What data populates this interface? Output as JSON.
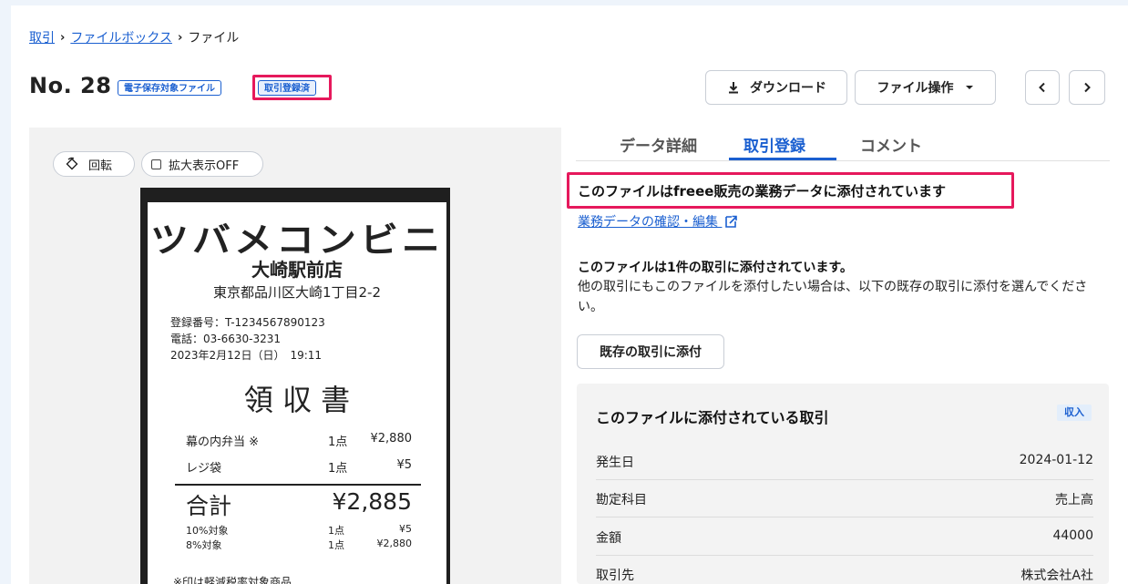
{
  "breadcrumb": {
    "item1": "取引",
    "item2": "ファイルボックス",
    "current": "ファイル",
    "separator": "›"
  },
  "header": {
    "title": "No. 28",
    "badge_storage": "電子保存対象ファイル",
    "badge_registered": "取引登録済"
  },
  "toolbar": {
    "download_label": "ダウンロード",
    "file_ops_label": "ファイル操作",
    "prev_icon": "chevron-left-icon",
    "next_icon": "chevron-right-icon"
  },
  "viewer": {
    "rotate_label": "回転",
    "zoom_label": "拡大表示OFF"
  },
  "receipt": {
    "store_name": "ツバメコンビニ",
    "branch": "大崎駅前店",
    "address": "東京都品川区大崎1丁目2-2",
    "reg_no": "登録番号：T-1234567890123",
    "phone": "電話：03-6630-3231",
    "datetime": "2023年2月12日（日）　19:11",
    "doc_title": "領 収 書",
    "items": [
      {
        "name": "幕の内弁当 ※",
        "qty": "1点",
        "price": "¥2,880"
      },
      {
        "name": "レジ袋",
        "qty": "1点",
        "price": "¥5"
      }
    ],
    "total_label": "合計",
    "total_value": "¥2,885",
    "tax_rows": [
      {
        "name": "10%対象",
        "qty": "1点",
        "price": "¥5"
      },
      {
        "name": "8%対象",
        "qty": "1点",
        "price": "¥2,880"
      }
    ],
    "footnote": "※印は軽減税率対象商品"
  },
  "tabs": [
    {
      "label": "データ詳細",
      "active": false
    },
    {
      "label": "取引登録",
      "active": true
    },
    {
      "label": "コメント",
      "active": false
    }
  ],
  "panel": {
    "notice": "このファイルはfreee販売の業務データに添付されています",
    "link": "業務データの確認・編集",
    "attached_count_text": "このファイルは1件の取引に添付されています。",
    "help_text": "他の取引にもこのファイルを添付したい場合は、以下の既存の取引に添付を選んでください。",
    "attach_button": "既存の取引に添付",
    "card_title": "このファイルに添付されている取引",
    "card_tag": "収入",
    "rows": [
      {
        "label": "発生日",
        "value": "2024-01-12"
      },
      {
        "label": "勘定科目",
        "value": "売上高"
      },
      {
        "label": "金額",
        "value": "44000"
      },
      {
        "label": "取引先",
        "value": "株式会社A社"
      }
    ]
  },
  "colors": {
    "accent": "#1a5fd0",
    "highlight": "#e6195c",
    "card_bg": "#f3f3f3",
    "viewer_bg": "#f2f2f2"
  }
}
